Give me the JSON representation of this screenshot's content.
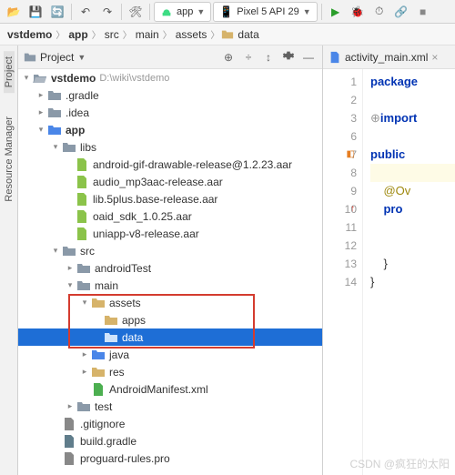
{
  "toolbar": {
    "app_config": "app",
    "device": "Pixel 5 API 29"
  },
  "breadcrumbs": [
    "vstdemo",
    "app",
    "src",
    "main",
    "assets",
    "data"
  ],
  "panel": {
    "title": "Project"
  },
  "side": {
    "project": "Project",
    "res_mgr": "Resource Manager"
  },
  "tree": {
    "root": {
      "label": "vstdemo",
      "path": "D:\\wiki\\vstdemo"
    },
    "gradle_dir": ".gradle",
    "idea_dir": ".idea",
    "app": "app",
    "libs": "libs",
    "aar1": "android-gif-drawable-release@1.2.23.aar",
    "aar2": "audio_mp3aac-release.aar",
    "aar3": "lib.5plus.base-release.aar",
    "aar4": "oaid_sdk_1.0.25.aar",
    "aar5": "uniapp-v8-release.aar",
    "src": "src",
    "androidTest": "androidTest",
    "main": "main",
    "assets": "assets",
    "apps": "apps",
    "data": "data",
    "java": "java",
    "res": "res",
    "manifest": "AndroidManifest.xml",
    "test": "test",
    "gitignore": ".gitignore",
    "buildgradle": "build.gradle",
    "proguard": "proguard-rules.pro"
  },
  "editor": {
    "tab": "activity_main.xml",
    "lines": {
      "l1": "package",
      "l3": "import",
      "l7": "public",
      "l9": "@Ov",
      "l10": "pro",
      "l13": "}",
      "l14": "}"
    },
    "gutter": [
      "1",
      "2",
      "3",
      "6",
      "7",
      "8",
      "9",
      "10",
      "11",
      "12",
      "13",
      "14"
    ]
  },
  "watermark": "CSDN @疯狂的太阳"
}
